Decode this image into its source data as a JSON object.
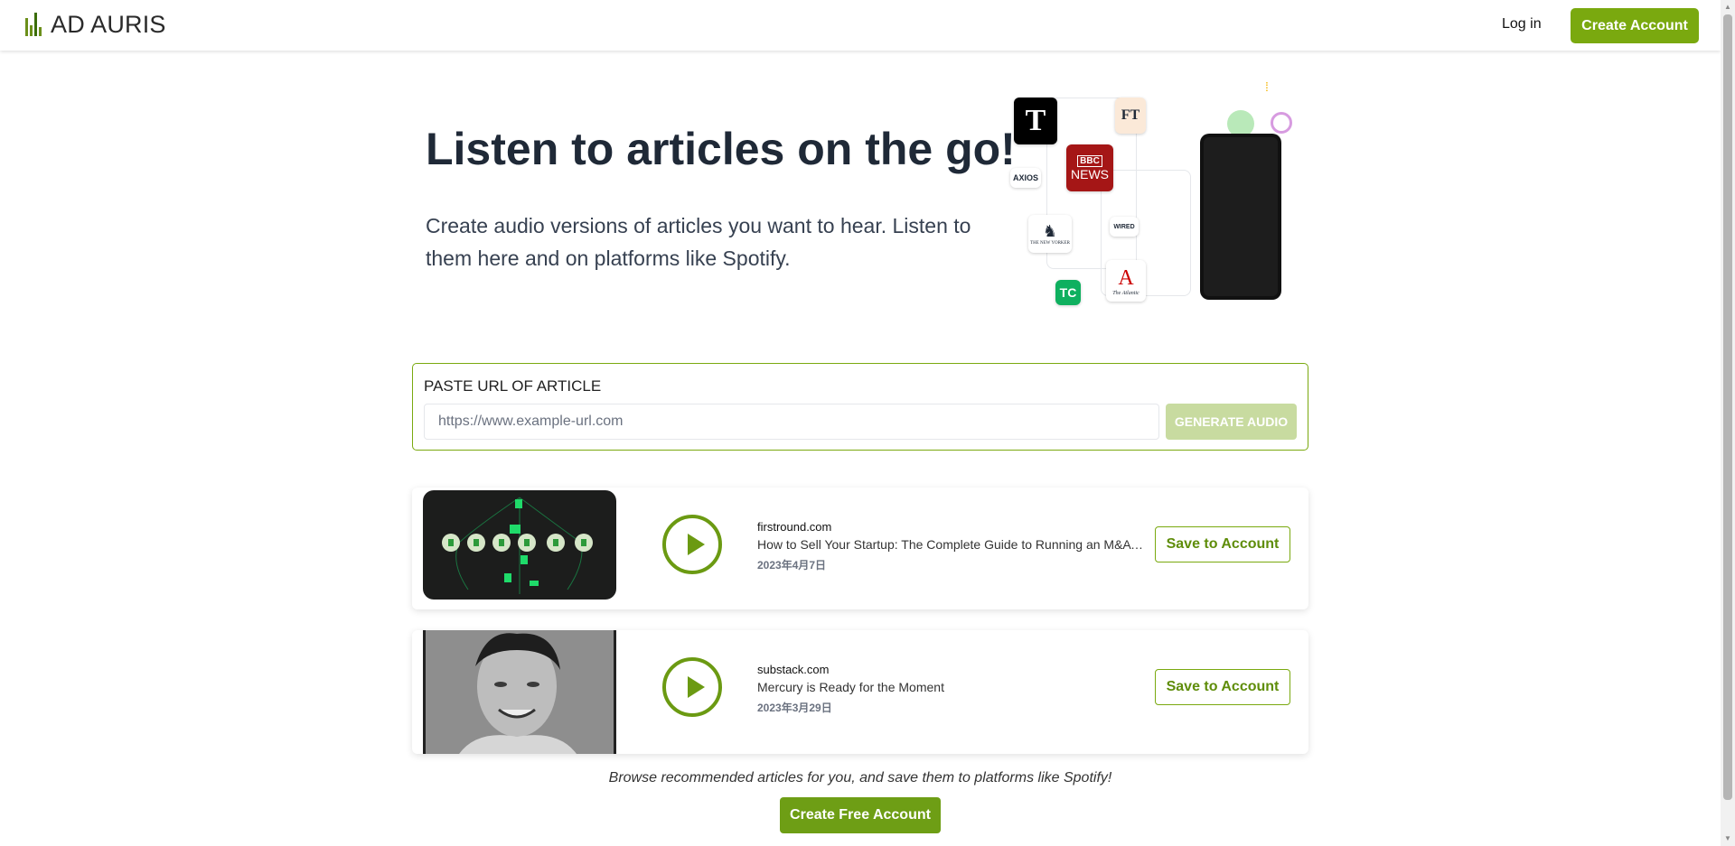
{
  "brand": {
    "name": "AD AURIS"
  },
  "nav": {
    "login": "Log in",
    "create_account": "Create Account"
  },
  "hero": {
    "title": "Listen to articles on the go!",
    "subtitle": "Create audio versions of articles you want to hear. Listen to them here and on platforms like Spotify."
  },
  "illustration": {
    "logos": [
      "T",
      "FT",
      "BBC",
      "NEWS",
      "AXIOS",
      "THE NEW YORKER",
      "WIRED",
      "A",
      "The Atlantic",
      "TC"
    ]
  },
  "url_form": {
    "label": "PASTE URL OF ARTICLE",
    "placeholder": "https://www.example-url.com",
    "button": "GENERATE AUDIO"
  },
  "articles": [
    {
      "source": "firstround.com",
      "title": "How to Sell Your Startup: The Complete Guide to Running an M&A Process",
      "date": "2023年4月7日",
      "save": "Save to Account"
    },
    {
      "source": "substack.com",
      "title": "Mercury is Ready for the Moment",
      "date": "2023年3月29日",
      "save": "Save to Account"
    }
  ],
  "footer": {
    "browse": "Browse recommended articles for you, and save them to platforms like Spotify!",
    "cta": "Create Free Account"
  },
  "colors": {
    "accent": "#7aa90f",
    "accent_light": "#c8dba0"
  }
}
